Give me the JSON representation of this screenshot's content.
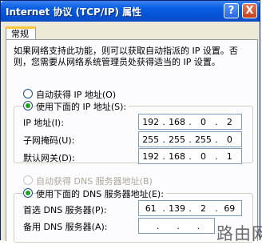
{
  "window": {
    "title": "Internet 协议 (TCP/IP) 属性",
    "help_glyph": "?",
    "close_glyph": "X"
  },
  "tabs": [
    {
      "label": "常规"
    }
  ],
  "description": "如果网络支持此功能，则可以获取自动指派的 IP 设置。否则，您需要从网络系统管理员处获得适当的 IP 设置。",
  "ip": {
    "auto_label": "自动获得 IP 地址(O)",
    "manual_label": "使用下面的 IP 地址(S):",
    "selected": "manual",
    "fields": [
      {
        "label": "IP 地址(I):",
        "octets": [
          "192",
          "168",
          "0",
          "2"
        ]
      },
      {
        "label": "子网掩码(U):",
        "octets": [
          "255",
          "255",
          "255",
          "0"
        ]
      },
      {
        "label": "默认网关(D):",
        "octets": [
          "192",
          "168",
          "0",
          "1"
        ]
      }
    ]
  },
  "dns": {
    "auto_label": "自动获得 DNS 服务器地址(B)",
    "manual_label": "使用下面的 DNS 服务器地址(E):",
    "selected": "manual",
    "fields": [
      {
        "label": "首选 DNS 服务器(P):",
        "octets": [
          "61",
          "139",
          "2",
          "69"
        ]
      },
      {
        "label": "备用 DNS 服务器(A):",
        "octets": [
          "",
          "",
          "",
          ""
        ]
      }
    ]
  },
  "watermark": "路由网"
}
